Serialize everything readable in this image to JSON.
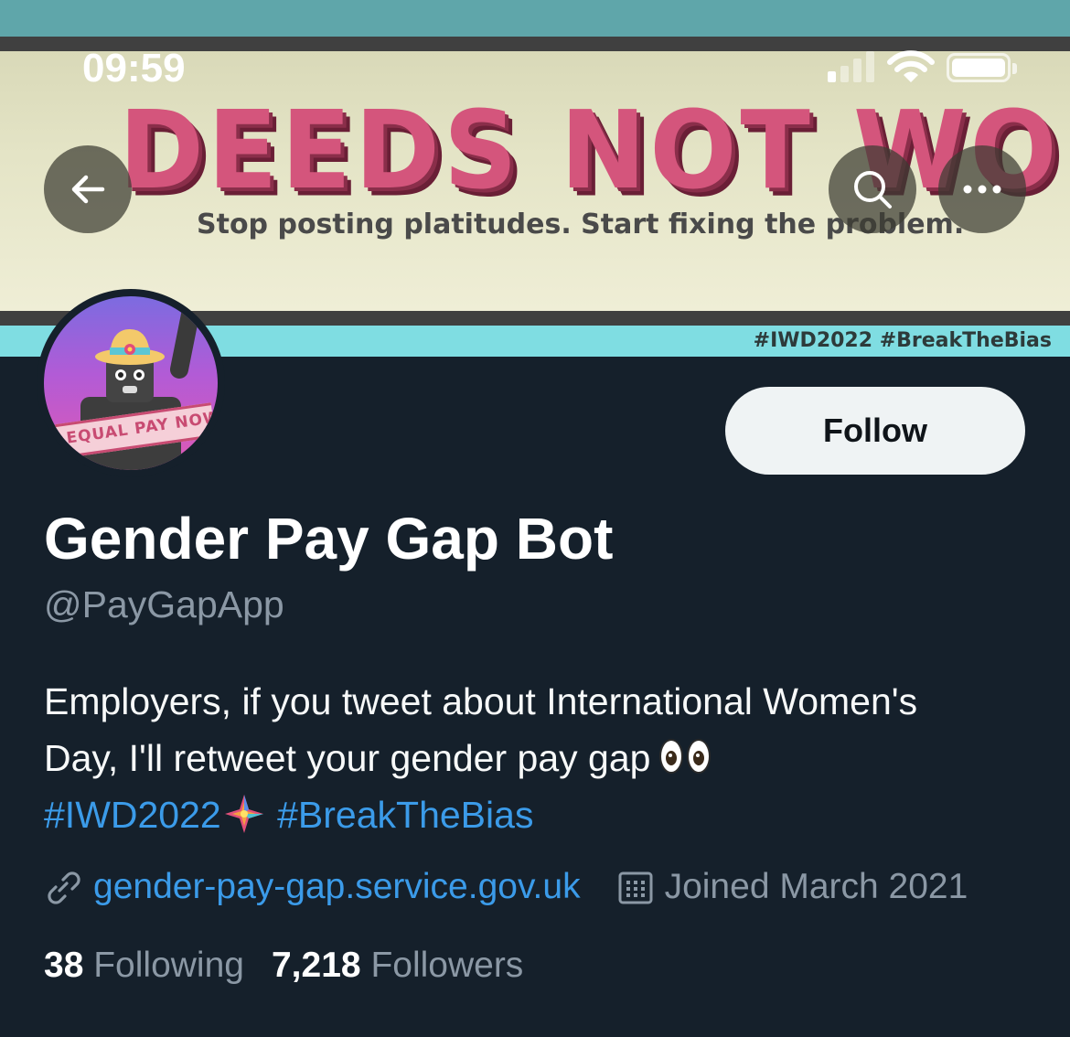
{
  "status_bar": {
    "time": "09:59"
  },
  "banner": {
    "title": "DEEDS NOT WORDS",
    "subtitle": "Stop posting platitudes. Start fixing the problem.",
    "hashtags": "#IWD2022 #BreakTheBias",
    "colors": {
      "teal": "#5fa6aa",
      "paper": "#e4e4c6",
      "title_pink": "#d4557c",
      "cyan": "#7fdde2"
    }
  },
  "avatar": {
    "ribbon_text": "EQUAL PAY NOW"
  },
  "profile": {
    "follow_label": "Follow",
    "display_name": "Gender Pay Gap Bot",
    "handle": "@PayGapApp",
    "bio": {
      "line1": "Employers, if you tweet about International Women's",
      "line2": "Day, I'll retweet your gender pay gap",
      "hashtag1": "#IWD2022",
      "hashtag2": "#BreakTheBias"
    },
    "website": "gender-pay-gap.service.gov.uk",
    "joined": "Joined March 2021",
    "following_count": "38",
    "following_label": "Following",
    "followers_count": "7,218",
    "followers_label": "Followers"
  },
  "icons": {
    "back": "arrow-left-icon",
    "search": "search-icon",
    "more": "more-icon",
    "link": "link-icon",
    "calendar": "calendar-icon"
  },
  "theme": {
    "background": "#15202b",
    "accent": "#3b9be9",
    "muted": "#8b98a5"
  }
}
